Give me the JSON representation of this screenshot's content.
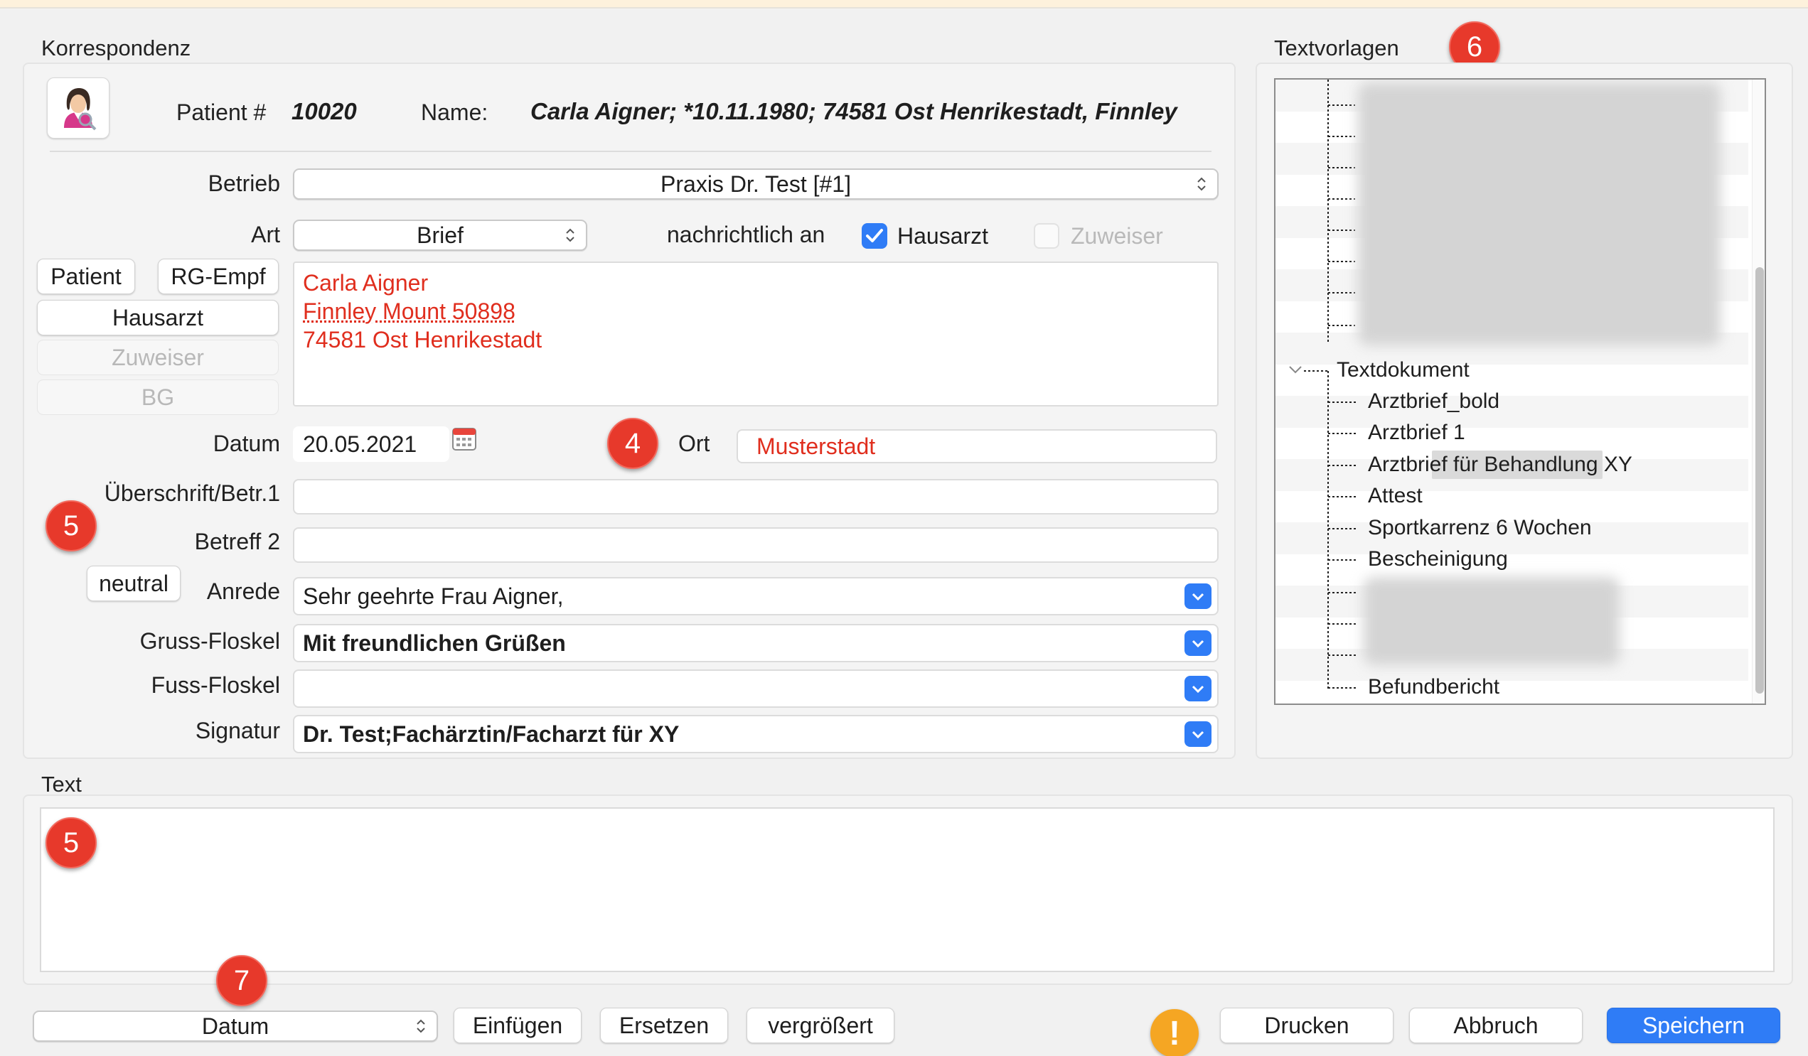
{
  "korrespondenz": {
    "title": "Korrespondenz",
    "patient_label": "Patient #",
    "patient_number": "10020",
    "name_label": "Name:",
    "name_value": "Carla Aigner; *10.11.1980; 74581 Ost Henrikestadt, Finnley"
  },
  "form": {
    "betrieb_label": "Betrieb",
    "betrieb_value": "Praxis Dr. Test [#1]",
    "art_label": "Art",
    "art_value": "Brief",
    "nachrichtlich_label": "nachrichtlich an",
    "hausarzt_check_label": "Hausarzt",
    "hausarzt_checked": true,
    "zuweiser_check_label": "Zuweiser",
    "zuweiser_checked": false,
    "address_buttons": {
      "patient": "Patient",
      "rg_empf": "RG-Empf",
      "hausarzt": "Hausarzt",
      "zuweiser": "Zuweiser",
      "bg": "BG"
    },
    "address_lines": [
      "Carla Aigner",
      "Finnley Mount 50898",
      "74581 Ost Henrikestadt"
    ],
    "datum_label": "Datum",
    "datum_value": "20.05.2021",
    "ort_label": "Ort",
    "ort_value": "Musterstadt",
    "ueberschrift_label": "Überschrift/Betr.1",
    "ueberschrift_value": "",
    "betreff2_label": "Betreff 2",
    "betreff2_value": "",
    "neutral_button": "neutral",
    "anrede_label": "Anrede",
    "anrede_value": "Sehr geehrte Frau Aigner,",
    "gruss_label": "Gruss-Floskel",
    "gruss_value": "Mit freundlichen Grüßen",
    "fuss_label": "Fuss-Floskel",
    "fuss_value": "",
    "signatur_label": "Signatur",
    "signatur_value": "Dr. Test;Fachärztin/Facharzt für XY"
  },
  "textvorlagen": {
    "title": "Textvorlagen",
    "folder": "Textdokument",
    "items": [
      "Arztbrief_bold",
      "Arztbrief 1",
      "Arztbrief für Behandlung XY",
      "Attest",
      "Sportkarrenz 6 Wochen",
      "Bescheinigung",
      "Befundbericht"
    ]
  },
  "text_section": {
    "title": "Text",
    "value": ""
  },
  "badges": {
    "four": "4",
    "five_a": "5",
    "five_b": "5",
    "six": "6",
    "seven": "7"
  },
  "bottom": {
    "field_select": "Datum",
    "einfuegen": "Einfügen",
    "ersetzen": "Ersetzen",
    "vergroessert": "vergrößert",
    "warning_glyph": "!",
    "drucken": "Drucken",
    "abbruch": "Abbruch",
    "speichern": "Speichern"
  },
  "colors": {
    "accent": "#2f7cf6",
    "badge": "#e7392b",
    "address_text": "#e02e1e",
    "warning": "#f5a623"
  }
}
